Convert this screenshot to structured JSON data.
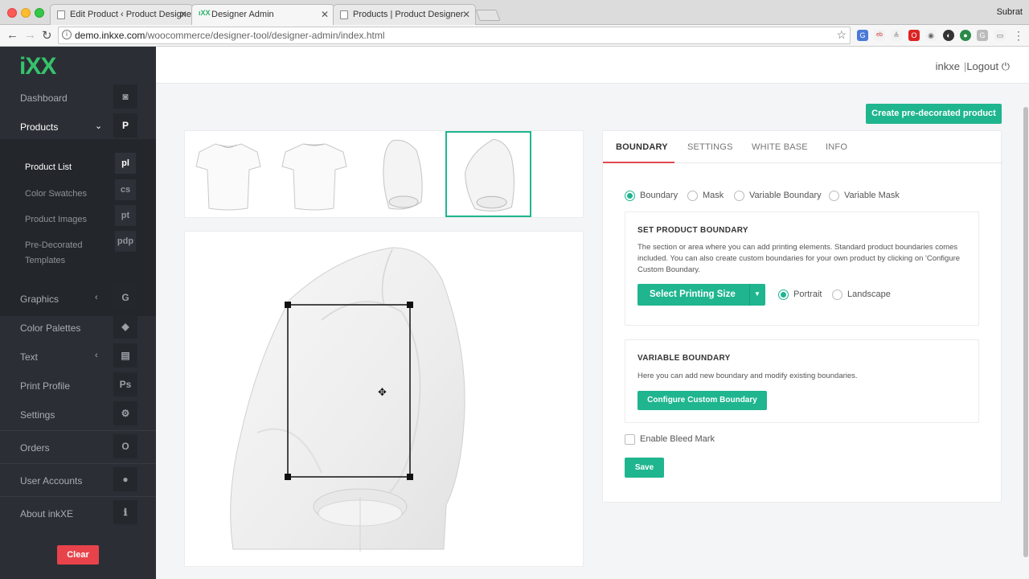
{
  "browser": {
    "tabs": [
      {
        "title": "Edit Product ‹ Product Designer"
      },
      {
        "title": "Designer Admin"
      },
      {
        "title": "Products | Product Designer"
      }
    ],
    "profile_name": "Subrat",
    "url_host": "demo.inkxe.com",
    "url_path": "/woocommerce/designer-tool/designer-admin/index.html"
  },
  "sidebar": {
    "logo": "iXX",
    "items": [
      {
        "label": "Dashboard",
        "badge": "◙"
      },
      {
        "label": "Products",
        "badge": "P",
        "chevron": "⌄"
      },
      {
        "label": "Graphics",
        "badge": "G",
        "chevron": "‹"
      },
      {
        "label": "Color Palettes",
        "badge": "◆"
      },
      {
        "label": "Text",
        "badge": "▤",
        "chevron": "‹"
      },
      {
        "label": "Print Profile",
        "badge": "Ps"
      },
      {
        "label": "Settings",
        "badge": "⚙"
      },
      {
        "label": "Orders",
        "badge": "O"
      },
      {
        "label": "User Accounts",
        "badge": "●"
      },
      {
        "label": "About inkXE",
        "badge": "ℹ"
      }
    ],
    "sub_items": [
      {
        "label": "Product List",
        "badge": "pl"
      },
      {
        "label": "Color Swatches",
        "badge": "cs"
      },
      {
        "label": "Product Images",
        "badge": "pt"
      },
      {
        "label": "Pre-Decorated Templates",
        "badge": "pdp"
      }
    ],
    "clear_label": "Clear"
  },
  "header": {
    "user": "inkxe",
    "logout": "Logout"
  },
  "main": {
    "create_label": "Create pre-decorated product",
    "tabs": [
      {
        "label": "BOUNDARY"
      },
      {
        "label": "SETTINGS"
      },
      {
        "label": "WHITE BASE"
      },
      {
        "label": "INFO"
      }
    ],
    "boundary_types": [
      {
        "label": "Boundary"
      },
      {
        "label": "Mask"
      },
      {
        "label": "Variable Boundary"
      },
      {
        "label": "Variable Mask"
      }
    ],
    "set_boundary": {
      "title": "SET PRODUCT BOUNDARY",
      "description": "The section or area where you can add printing elements. Standard product boundaries comes included. You can also create custom boundaries for your own product by clicking on 'Configure Custom Boundary.",
      "size_button": "Select Printing Size",
      "orientation": [
        {
          "label": "Portrait"
        },
        {
          "label": "Landscape"
        }
      ]
    },
    "variable_boundary": {
      "title": "VARIABLE BOUNDARY",
      "description": "Here you can add new boundary and modify existing boundaries.",
      "button": "Configure Custom Boundary"
    },
    "bleed_label": "Enable Bleed Mark",
    "save_label": "Save"
  },
  "colors": {
    "accent": "#1fb58f",
    "danger": "#e8434b",
    "sidebar_bg": "#2b2f35",
    "tab_underline": "#e04a52"
  }
}
